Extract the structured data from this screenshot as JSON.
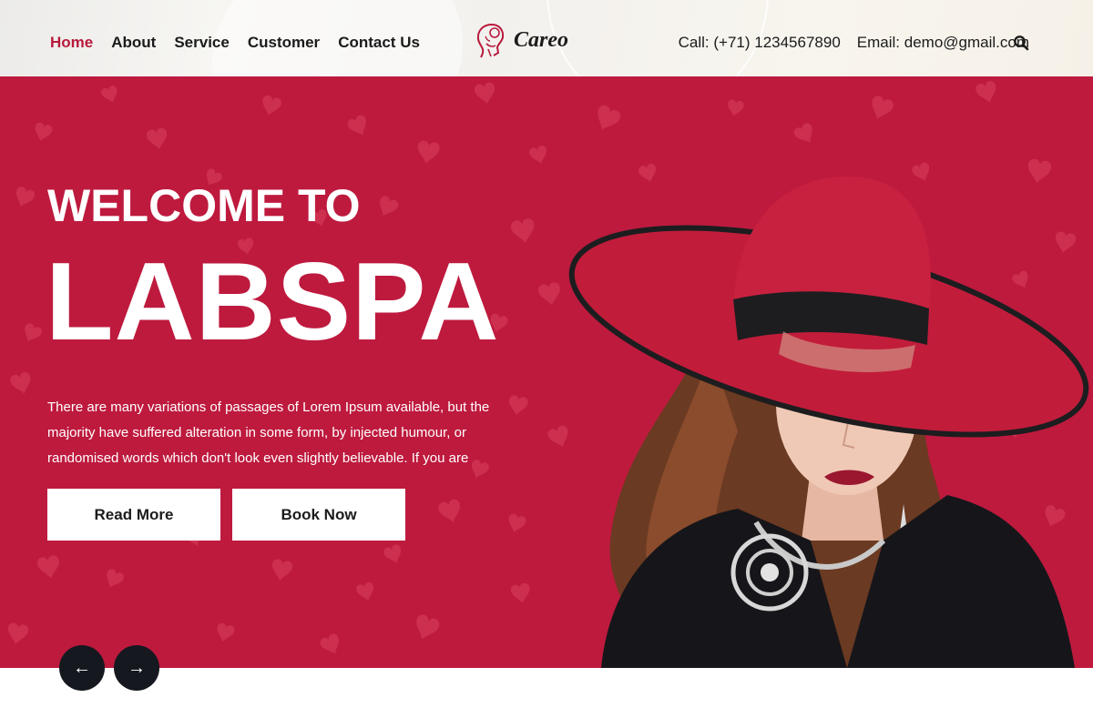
{
  "nav": {
    "items": [
      {
        "label": "Home",
        "active": true
      },
      {
        "label": "About",
        "active": false
      },
      {
        "label": "Service",
        "active": false
      },
      {
        "label": "Customer",
        "active": false
      },
      {
        "label": "Contact Us",
        "active": false
      }
    ]
  },
  "brand": {
    "name": "Careo",
    "icon": "woman-face-logo-icon"
  },
  "contact": {
    "phone": "Call: (+71) 1234567890",
    "email": "Email: demo@gmail.com"
  },
  "hero": {
    "title_small": "WELCOME TO",
    "title_large": "LABSPA",
    "description": "There are many variations of passages of Lorem Ipsum available, but the majority have suffered alteration in some form, by injected humour, or randomised words which don't look even slightly believable. If you are",
    "read_more": "Read More",
    "book_now": "Book Now"
  },
  "slider": {
    "prev_icon": "arrow-left-icon",
    "next_icon": "arrow-right-icon",
    "prev_glyph": "←",
    "next_glyph": "→"
  },
  "colors": {
    "accent": "#be1a3e",
    "nav_active": "#b8193c",
    "text_dark": "#1b1b1b",
    "arrow_bg": "#161820"
  }
}
